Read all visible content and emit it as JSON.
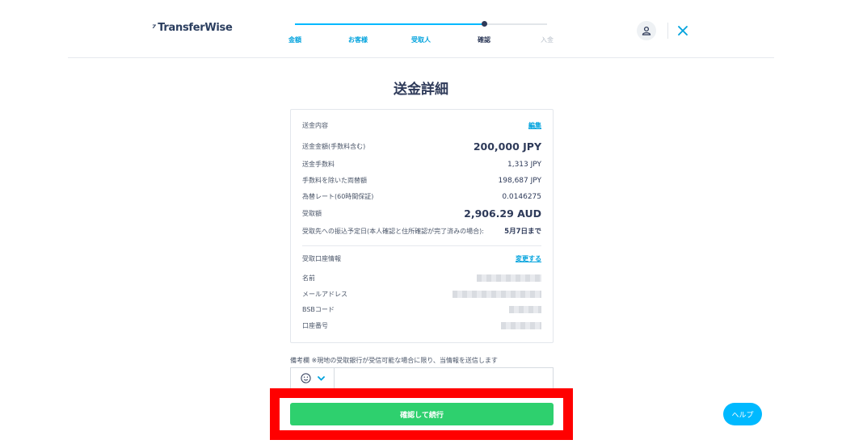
{
  "header": {
    "logo_mark": "⁷",
    "logo_text": "TransferWise",
    "steps": [
      {
        "label": "金額"
      },
      {
        "label": "お客様"
      },
      {
        "label": "受取人"
      },
      {
        "label": "確認"
      },
      {
        "label": "入金"
      }
    ],
    "progress_fraction": 0.75
  },
  "page_title": "送金詳細",
  "transfer": {
    "section_label": "送金内容",
    "edit_link": "編集",
    "rows": [
      {
        "label": "送金金額(手数料含む)",
        "value": "200,000 JPY"
      },
      {
        "label": "送金手数料",
        "value": "1,313 JPY"
      },
      {
        "label": "手数料を除いた両替額",
        "value": "198,687 JPY"
      },
      {
        "label": "為替レート(60時間保証)",
        "value": "0.0146275"
      },
      {
        "label": "受取額",
        "value": "2,906.29 AUD"
      },
      {
        "label": "受取先への振込予定日(本人確認と住所確認が完了済みの場合):",
        "value": "5月7日まで"
      }
    ]
  },
  "recipient": {
    "section_label": "受取口座情報",
    "change_link": "変更する",
    "rows": [
      {
        "label": "名前"
      },
      {
        "label": "メールアドレス"
      },
      {
        "label": "BSBコード"
      },
      {
        "label": "口座番号"
      }
    ]
  },
  "memo": {
    "label": "備考欄 ※現地の受取銀行が受信可能な場合に限り、当情報を送信します",
    "value": ""
  },
  "confirm_button": "確認して続行",
  "help_button": "ヘルプ",
  "colors": {
    "accent": "#00b9ff",
    "primary_text": "#2e3a59",
    "confirm": "#2ed06e",
    "highlight": "#ff0000"
  }
}
